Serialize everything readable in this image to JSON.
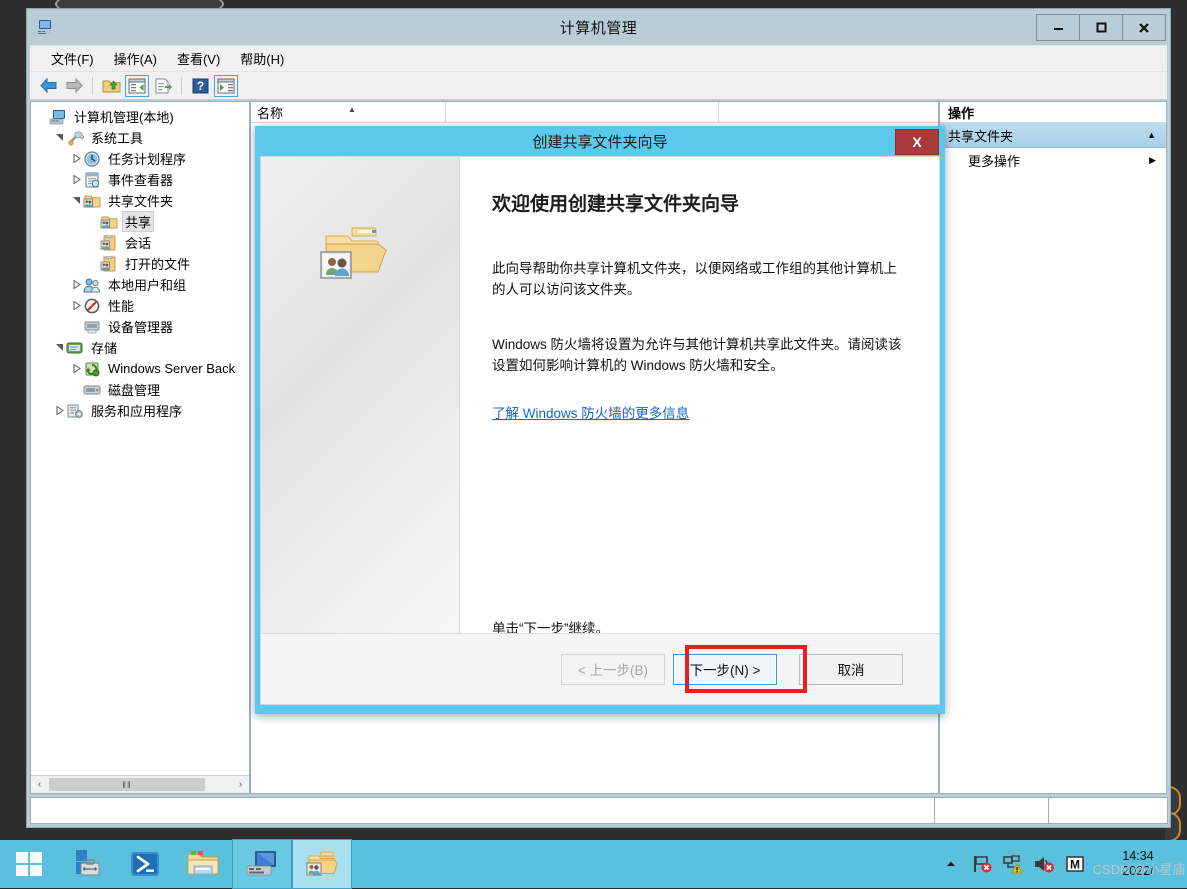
{
  "window": {
    "title": "计算机管理",
    "icon": "computer-management-icon",
    "minimize_label": "–",
    "maximize_label": "□",
    "close_label": "✕"
  },
  "menubar": {
    "items": [
      {
        "label": "文件(F)",
        "name": "menu-file"
      },
      {
        "label": "操作(A)",
        "name": "menu-action"
      },
      {
        "label": "查看(V)",
        "name": "menu-view"
      },
      {
        "label": "帮助(H)",
        "name": "menu-help"
      }
    ]
  },
  "toolbar": {
    "buttons": [
      {
        "icon": "back-arrow-icon",
        "framed": false
      },
      {
        "icon": "forward-arrow-icon",
        "framed": false
      },
      {
        "icon": "up-folder-icon",
        "framed": false
      },
      {
        "icon": "show-hide-tree-icon",
        "framed": true
      },
      {
        "icon": "export-list-icon",
        "framed": false
      },
      {
        "icon": "help-icon",
        "framed": false
      },
      {
        "icon": "show-action-pane-icon",
        "framed": true
      }
    ]
  },
  "tree": {
    "nodes": [
      {
        "label": "计算机管理(本地)",
        "indent": 0,
        "twist": "",
        "icon": "computer-icon",
        "selected": false
      },
      {
        "label": "系统工具",
        "indent": 1,
        "twist": "expanded",
        "icon": "system-tools-icon",
        "selected": false
      },
      {
        "label": "任务计划程序",
        "indent": 2,
        "twist": "collapsed",
        "icon": "task-scheduler-icon",
        "selected": false
      },
      {
        "label": "事件查看器",
        "indent": 2,
        "twist": "collapsed",
        "icon": "event-viewer-icon",
        "selected": false
      },
      {
        "label": "共享文件夹",
        "indent": 2,
        "twist": "expanded",
        "icon": "shared-folders-icon",
        "selected": false
      },
      {
        "label": "共享",
        "indent": 3,
        "twist": "",
        "icon": "shares-icon",
        "selected": true
      },
      {
        "label": "会话",
        "indent": 3,
        "twist": "",
        "icon": "sessions-icon",
        "selected": false
      },
      {
        "label": "打开的文件",
        "indent": 3,
        "twist": "",
        "icon": "open-files-icon",
        "selected": false
      },
      {
        "label": "本地用户和组",
        "indent": 2,
        "twist": "collapsed",
        "icon": "local-users-groups-icon",
        "selected": false
      },
      {
        "label": "性能",
        "indent": 2,
        "twist": "collapsed",
        "icon": "performance-icon",
        "selected": false
      },
      {
        "label": "设备管理器",
        "indent": 2,
        "twist": "",
        "icon": "device-manager-icon",
        "selected": false
      },
      {
        "label": "存储",
        "indent": 1,
        "twist": "expanded",
        "icon": "storage-icon",
        "selected": false
      },
      {
        "label": "Windows Server Back",
        "indent": 2,
        "twist": "collapsed",
        "icon": "windows-server-backup-icon",
        "selected": false
      },
      {
        "label": "磁盘管理",
        "indent": 2,
        "twist": "",
        "icon": "disk-management-icon",
        "selected": false
      },
      {
        "label": "服务和应用程序",
        "indent": 1,
        "twist": "collapsed",
        "icon": "services-applications-icon",
        "selected": false
      }
    ],
    "hscroll": {
      "left_arrow": "‹",
      "right_arrow": "›",
      "thumb_glyph": "‖‖"
    }
  },
  "list": {
    "columns": [
      {
        "label": "名称",
        "sort": "ascending",
        "sort_glyph": "▲"
      },
      {
        "label": "",
        "sort": "",
        "sort_glyph": ""
      }
    ],
    "rows": []
  },
  "actions": {
    "title": "操作",
    "group": {
      "label": "共享文件夹",
      "collapse_glyph": "▲"
    },
    "items": [
      {
        "label": "更多操作",
        "submenu_glyph": "▶"
      }
    ]
  },
  "wizard": {
    "title": "创建共享文件夹向导",
    "close_label": "X",
    "banner_icon": "shared-folder-large-icon",
    "heading": "欢迎使用创建共享文件夹向导",
    "paragraph1": "此向导帮助你共享计算机文件夹，以便网络或工作组的其他计算机上的人可以访问该文件夹。",
    "paragraph2": "Windows 防火墙将设置为允许与其他计算机共享此文件夹。请阅读该设置如何影响计算机的 Windows 防火墙和安全。",
    "link": "了解 Windows 防火墙的更多信息",
    "continue_text": "单击“下一步”继续。",
    "buttons": {
      "back": {
        "label": "< 上一步(B)",
        "disabled": true
      },
      "next": {
        "label": "下一步(N) >",
        "disabled": false,
        "highlighted": true
      },
      "cancel": {
        "label": "取消",
        "disabled": false
      }
    },
    "highlight_color": "#ee1c1c"
  },
  "taskbar": {
    "start_icon": "windows-start-icon",
    "apps": [
      {
        "name": "server-manager-icon",
        "state": "pinned"
      },
      {
        "name": "powershell-icon",
        "state": "pinned"
      },
      {
        "name": "file-explorer-icon",
        "state": "pinned"
      },
      {
        "name": "computer-management-icon",
        "state": "open"
      },
      {
        "name": "shared-folder-wizard-icon",
        "state": "active"
      }
    ],
    "tray": [
      {
        "name": "show-hidden-icons-chevron",
        "glyph": "▲"
      },
      {
        "name": "network-flag-error-icon"
      },
      {
        "name": "network-warning-icon"
      },
      {
        "name": "volume-muted-icon"
      },
      {
        "name": "mcafee-icon",
        "glyph": "M"
      }
    ],
    "clock": {
      "time": "14:34",
      "date": "2022/"
    },
    "watermark": "CSDN @小星庙"
  },
  "colors": {
    "desktop": "#2e2e2e",
    "window_chrome": "#b9cdd6",
    "taskbar": "#5bc0de",
    "dialog_titlebar": "#5bc8ec",
    "dialog_close": "#a93b3b",
    "link": "#1364c4",
    "action_group": "#a8cfe8"
  }
}
